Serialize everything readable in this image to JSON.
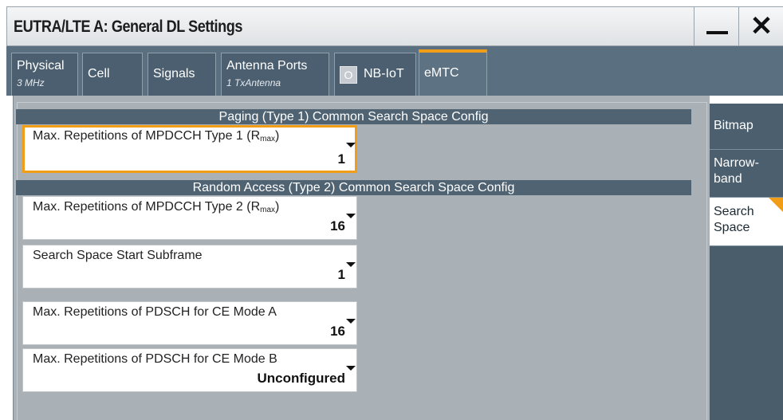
{
  "window": {
    "title": "EUTRA/LTE A: General DL Settings",
    "minimize_label": "",
    "close_symbol": "✕"
  },
  "tabs": [
    {
      "label": "Physical",
      "sublabel": "3 MHz"
    },
    {
      "label": "Cell",
      "sublabel": ""
    },
    {
      "label": "Signals",
      "sublabel": ""
    },
    {
      "label": "Antenna Ports",
      "sublabel": "1 TxAntenna"
    },
    {
      "label": "NB-IoT",
      "sublabel": "",
      "checkbox": "O"
    },
    {
      "label": "eMTC",
      "sublabel": "",
      "active": true
    }
  ],
  "sections": {
    "paging": "Paging (Type 1) Common Search Space Config",
    "random_access": "Random Access (Type 2) Common Search Space Config"
  },
  "fields": {
    "mpdcch_type1": {
      "label": "Max. Repetitions of MPDCCH Type 1 (R",
      "sub": "max",
      "close": ")",
      "value": "1"
    },
    "mpdcch_type2": {
      "label": "Max. Repetitions of MPDCCH Type 2 (R",
      "sub": "max",
      "close": ")",
      "value": "16"
    },
    "start_subframe": {
      "label": "Search Space Start Subframe",
      "value": "1"
    },
    "pdsch_mode_a": {
      "label": "Max. Repetitions of PDSCH for CE Mode A",
      "value": "16"
    },
    "pdsch_mode_b": {
      "label": "Max. Repetitions of PDSCH for CE Mode B",
      "value": "Unconfigured"
    }
  },
  "sidenav": {
    "bitmap": "Bitmap",
    "narrowband_1": "Narrow-",
    "narrowband_2": "band",
    "search_space_1": "Search",
    "search_space_2": "Space"
  },
  "colors": {
    "accent": "#f29d18",
    "tabbar": "#5a6f80",
    "section_header": "#4f6373"
  }
}
